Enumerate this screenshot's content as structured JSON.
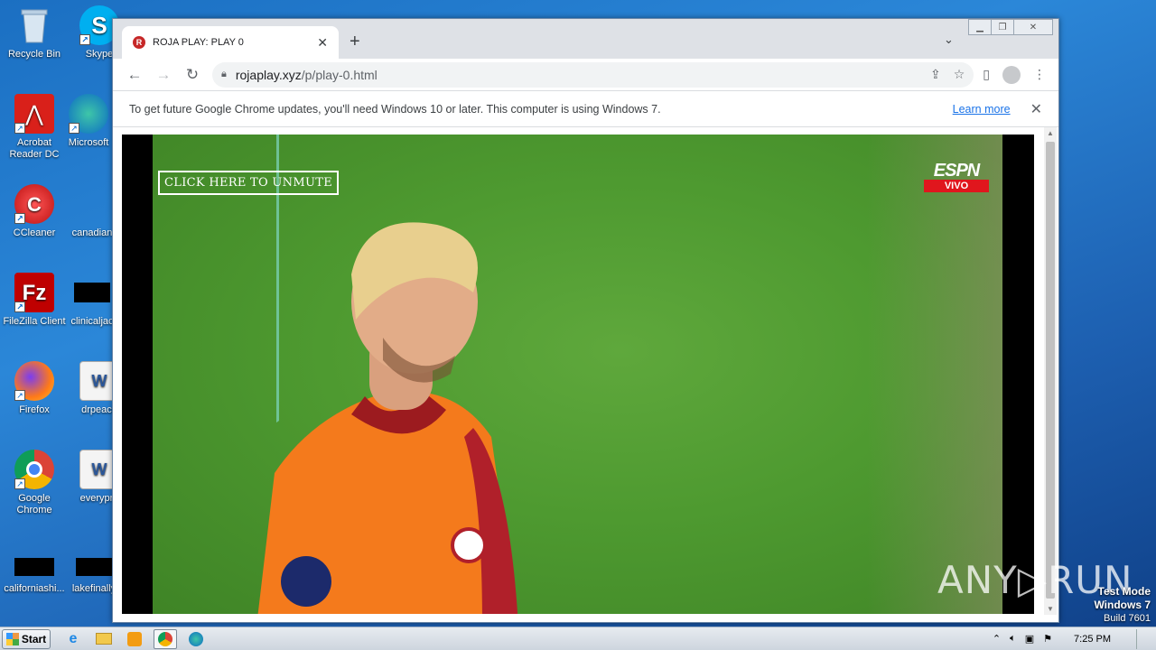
{
  "desktop": {
    "icons": [
      {
        "label": "Recycle Bin",
        "icon": "recycle-bin-icon"
      },
      {
        "label": "Skype",
        "icon": "skype-icon"
      },
      {
        "label": "Acrobat Reader DC",
        "icon": "acrobat-icon"
      },
      {
        "label": "Microsoft",
        "icon": "edge-icon"
      },
      {
        "label": "CCleaner",
        "icon": "ccleaner-icon"
      },
      {
        "label": "canadian",
        "icon": "file-icon"
      },
      {
        "label": "FileZilla Client",
        "icon": "filezilla-icon"
      },
      {
        "label": "clinicaljac",
        "icon": "file-icon"
      },
      {
        "label": "Firefox",
        "icon": "firefox-icon"
      },
      {
        "label": "drpeace",
        "icon": "word-doc-icon"
      },
      {
        "label": "Google Chrome",
        "icon": "chrome-icon"
      },
      {
        "label": "everypre",
        "icon": "word-doc-icon"
      },
      {
        "label": "californiashi...",
        "icon": "file-icon"
      },
      {
        "label": "lakefinally",
        "icon": "file-icon"
      }
    ]
  },
  "browser": {
    "tab_title": "ROJA PLAY: PLAY 0",
    "new_tab": "+",
    "url_host": "rojaplay.xyz",
    "url_path": "/p/play-0.html",
    "infobar_message": "To get future Google Chrome updates, you'll need Windows 10 or later. This computer is using Windows 7.",
    "infobar_link": "Learn more"
  },
  "player": {
    "unmute_label": "CLICK HERE TO UNMUTE",
    "broadcaster": "ESPN",
    "live_badge": "VIVO"
  },
  "watermark": "ANY▷RUN",
  "system": {
    "test_mode": "Test Mode",
    "os": "Windows 7",
    "build": "Build 7601",
    "clock": "7:25 PM",
    "start_label": "Start"
  },
  "colors": {
    "chrome_tabstrip": "#dee1e6",
    "link": "#1a73e8",
    "espn_red": "#e0161d",
    "desktop_blue": "#2b87d8"
  }
}
